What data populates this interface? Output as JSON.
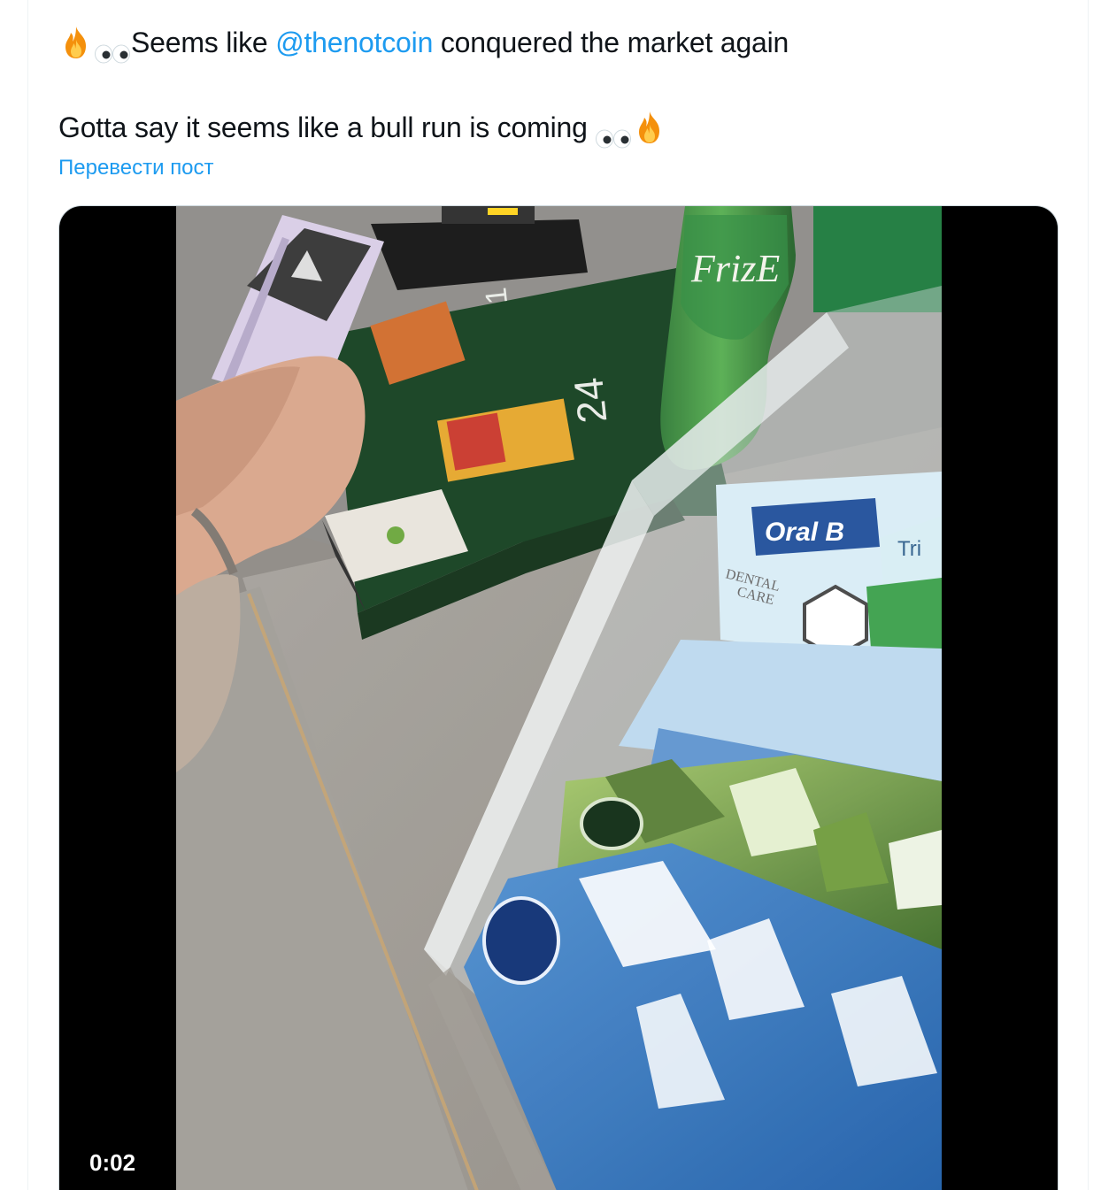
{
  "tweet": {
    "line1": {
      "prefix_icons": [
        "fire-icon",
        "eyes-icon"
      ],
      "text_before": "Seems like ",
      "mention": "@thenotcoin",
      "text_after": " conquered the market again"
    },
    "line2": {
      "text": "Gotta say it seems like a bull run is coming ",
      "suffix_icons": [
        "eyes-icon",
        "fire-icon"
      ]
    },
    "translate_label": "Перевести пост"
  },
  "media": {
    "type": "video",
    "timestamp": "0:02",
    "scene_text": {
      "bottle_brand": "FrizE",
      "box_brand": "Oral B",
      "box_label_1": "DENTAL",
      "box_label_2": "CARE",
      "box_side": "Tri"
    }
  },
  "colors": {
    "text": "#0f1419",
    "link": "#1d9bf0",
    "media_bg": "#000000",
    "border": "#cfd9de"
  }
}
